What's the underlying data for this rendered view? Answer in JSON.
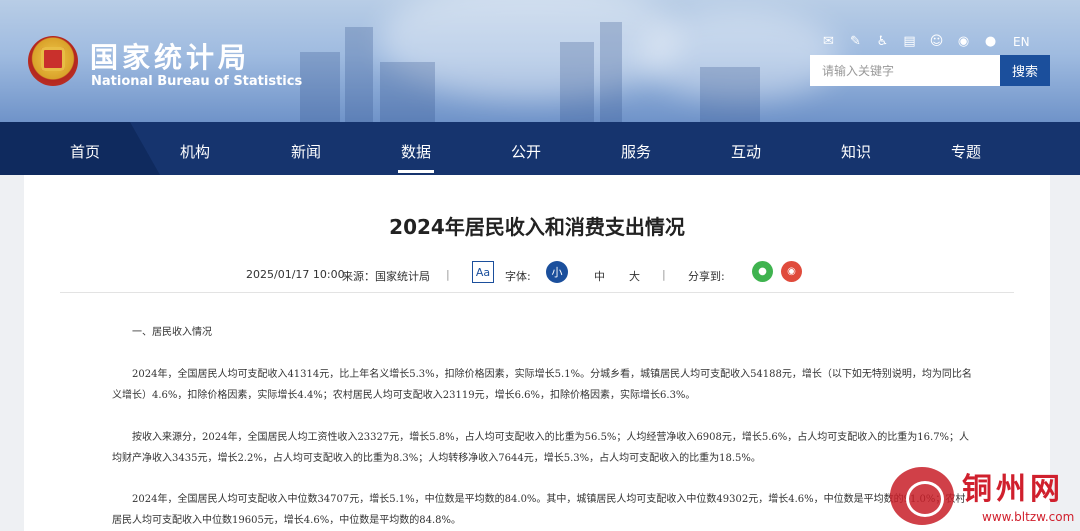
{
  "header": {
    "site_name_cn": "国家统计局",
    "site_name_en": "National Bureau of Statistics",
    "top_icons": [
      "mail-icon",
      "message-icon",
      "accessibility-icon",
      "print-icon",
      "robot-icon",
      "weibo-icon",
      "wechat-icon"
    ],
    "lang_switch": "EN",
    "search_placeholder": "请输入关键字",
    "search_button": "搜索"
  },
  "nav": {
    "items": [
      "首页",
      "机构",
      "新闻",
      "数据",
      "公开",
      "服务",
      "互动",
      "知识",
      "专题"
    ],
    "active_index": 3
  },
  "article": {
    "title": "2024年居民收入和消费支出情况",
    "date": "2025/01/17 10:00",
    "source": "来源：国家统计局",
    "font_icon": "Aa",
    "font_label": "字体:",
    "font_sizes": [
      "小",
      "中",
      "大"
    ],
    "share_label": "分享到:",
    "section1_heading": "一、居民收入情况",
    "p1": "2024年，全国居民人均可支配收入41314元，比上年名义增长5.3%，扣除价格因素，实际增长5.1%。分城乡看，城镇居民人均可支配收入54188元，增长（以下如无特别说明，均为同比名义增长）4.6%，扣除价格因素，实际增长4.4%；农村居民人均可支配收入23119元，增长6.6%，扣除价格因素，实际增长6.3%。",
    "p2": "按收入来源分，2024年，全国居民人均工资性收入23327元，增长5.8%，占人均可支配收入的比重为56.5%；人均经营净收入6908元，增长5.6%，占人均可支配收入的比重为16.7%；人均财产净收入3435元，增长2.2%，占人均可支配收入的比重为8.3%；人均转移净收入7644元，增长5.3%，占人均可支配收入的比重为18.5%。",
    "p3": "2024年，全国居民人均可支配收入中位数34707元，增长5.1%，中位数是平均数的84.0%。其中，城镇居民人均可支配收入中位数49302元，增长4.6%，中位数是平均数的91.0%；农村居民人均可支配收入中位数19605元，增长4.6%，中位数是平均数的84.8%。"
  },
  "watermark": {
    "name": "铜州网",
    "url": "www.bltzw.com"
  },
  "colors": {
    "nav_bg": "#16346e",
    "accent": "#1b4f9c",
    "watermark": "#d0202d"
  }
}
